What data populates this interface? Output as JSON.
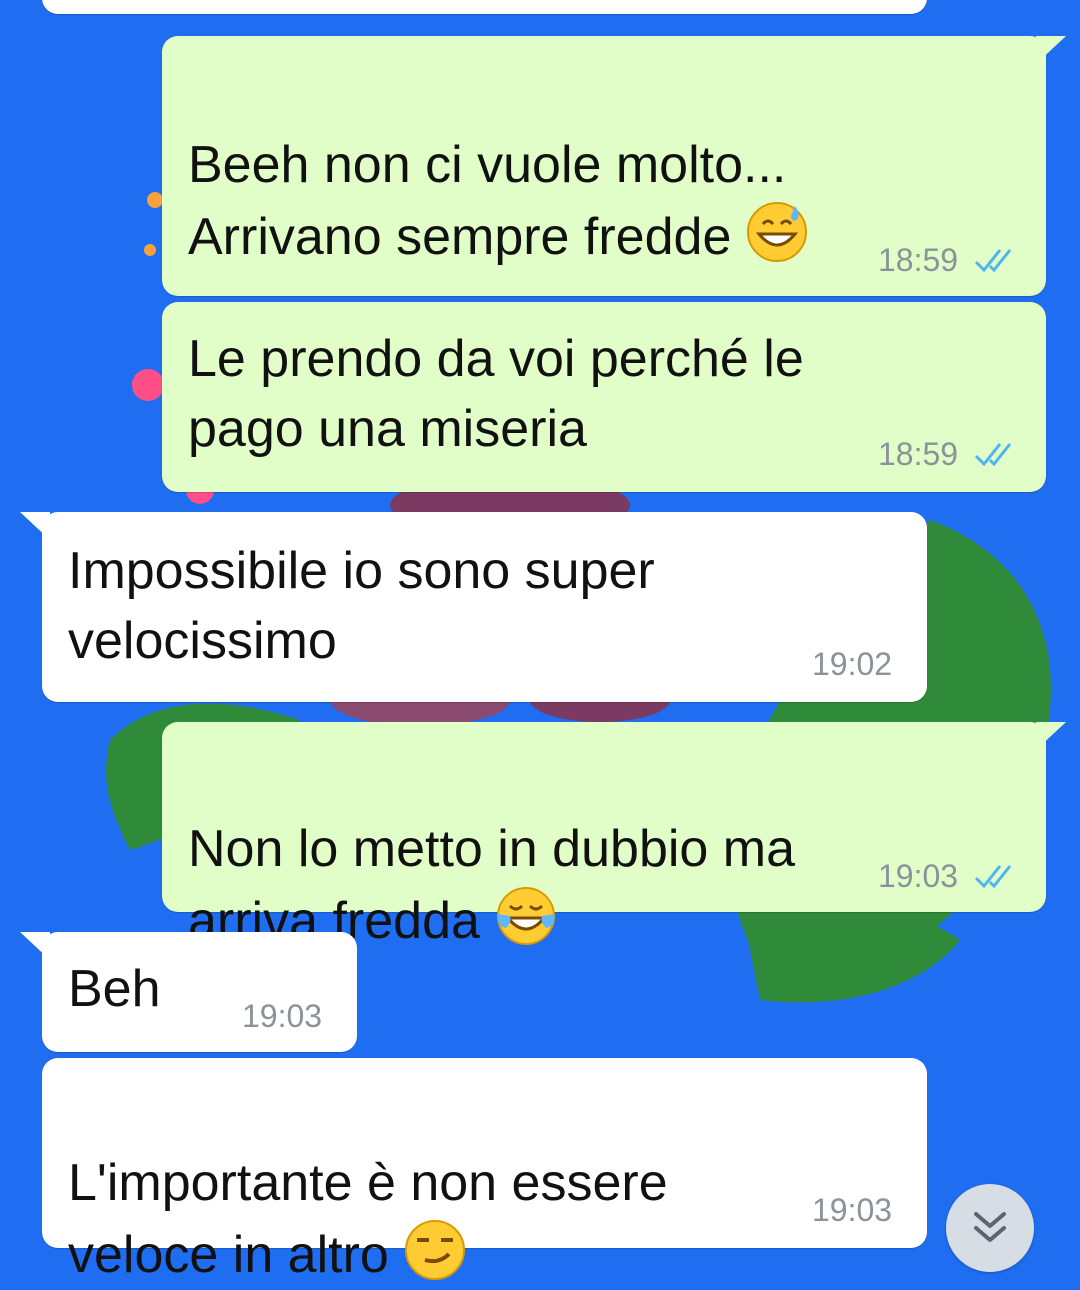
{
  "colors": {
    "background": "#1f6ef2",
    "outgoing_bubble": "#e2fec8",
    "incoming_bubble": "#ffffff",
    "timestamp": "#8a9399",
    "read_ticks": "#4fb5f0"
  },
  "messages": [
    {
      "direction": "outgoing",
      "text": "Beeh non ci vuole molto...\nArrivano sempre fredde",
      "emoji": "grinning-sweat-emoji",
      "time": "18:59",
      "status": "read-double-check-icon"
    },
    {
      "direction": "outgoing",
      "text": "Le prendo da voi perché le\npago una miseria",
      "time": "18:59",
      "status": "read-double-check-icon"
    },
    {
      "direction": "incoming",
      "text": "Impossibile io sono super\nvelocissimo",
      "time": "19:02"
    },
    {
      "direction": "outgoing",
      "text": "Non lo metto in dubbio ma\narriva fredda",
      "emoji": "tears-of-joy-emoji",
      "time": "19:03",
      "status": "read-double-check-icon"
    },
    {
      "direction": "incoming",
      "text": "Beh",
      "time": "19:03"
    },
    {
      "direction": "incoming",
      "text": "L'importante è non essere\nveloce in altro",
      "emoji": "smirking-face-emoji",
      "time": "19:03"
    }
  ],
  "scroll_button": {
    "icon": "double-chevron-down-icon"
  }
}
